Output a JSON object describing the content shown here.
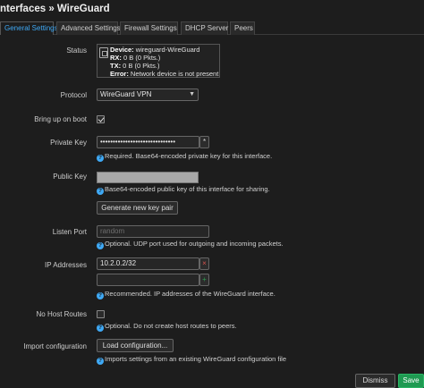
{
  "header": {
    "title": "nterfaces » WireGuard"
  },
  "tabs": [
    {
      "label": "General Settings"
    },
    {
      "label": "Advanced Settings"
    },
    {
      "label": "Firewall Settings"
    },
    {
      "label": "DHCP Server"
    },
    {
      "label": "Peers"
    }
  ],
  "status": {
    "label": "Status",
    "device_key": "Device:",
    "device_value": " wireguard-WireGuard",
    "rx_key": "RX:",
    "rx_value": " 0 B (0 Pkts.)",
    "tx_key": "TX:",
    "tx_value": " 0 B (0 Pkts.)",
    "error_key": "Error:",
    "error_value": " Network device is not present"
  },
  "protocol": {
    "label": "Protocol",
    "value": "WireGuard VPN",
    "icon": "chevron-down-icon"
  },
  "bring_up": {
    "label": "Bring up on boot",
    "checked": true
  },
  "private_key": {
    "label": "Private Key",
    "value": "••••••••••••••••••••••••••••••",
    "reveal_label": "*",
    "help": "Required. Base64-encoded private key for this interface."
  },
  "public_key": {
    "label": "Public Key",
    "help": "Base64-encoded public key of this interface for sharing."
  },
  "generate_button": "Generate new key pair",
  "listen_port": {
    "label": "Listen Port",
    "placeholder": "random",
    "help": "Optional. UDP port used for outgoing and incoming packets."
  },
  "ip_addresses": {
    "label": "IP Addresses",
    "value": "10.2.0.2/32",
    "remove_label": "×",
    "add_label": "+",
    "help": "Recommended. IP addresses of the WireGuard interface."
  },
  "no_host_routes": {
    "label": "No Host Routes",
    "checked": false,
    "help": "Optional. Do not create host routes to peers."
  },
  "import_config": {
    "label": "Import configuration",
    "button": "Load configuration...",
    "help": "Imports settings from an existing WireGuard configuration file"
  },
  "footer": {
    "dismiss": "Dismiss",
    "save": "Save"
  },
  "help_icon_glyph": "?",
  "colors": {
    "accent": "#3fa9f5",
    "save": "#1f9a52",
    "remove": "#d9534f",
    "add": "#2e9e50"
  }
}
